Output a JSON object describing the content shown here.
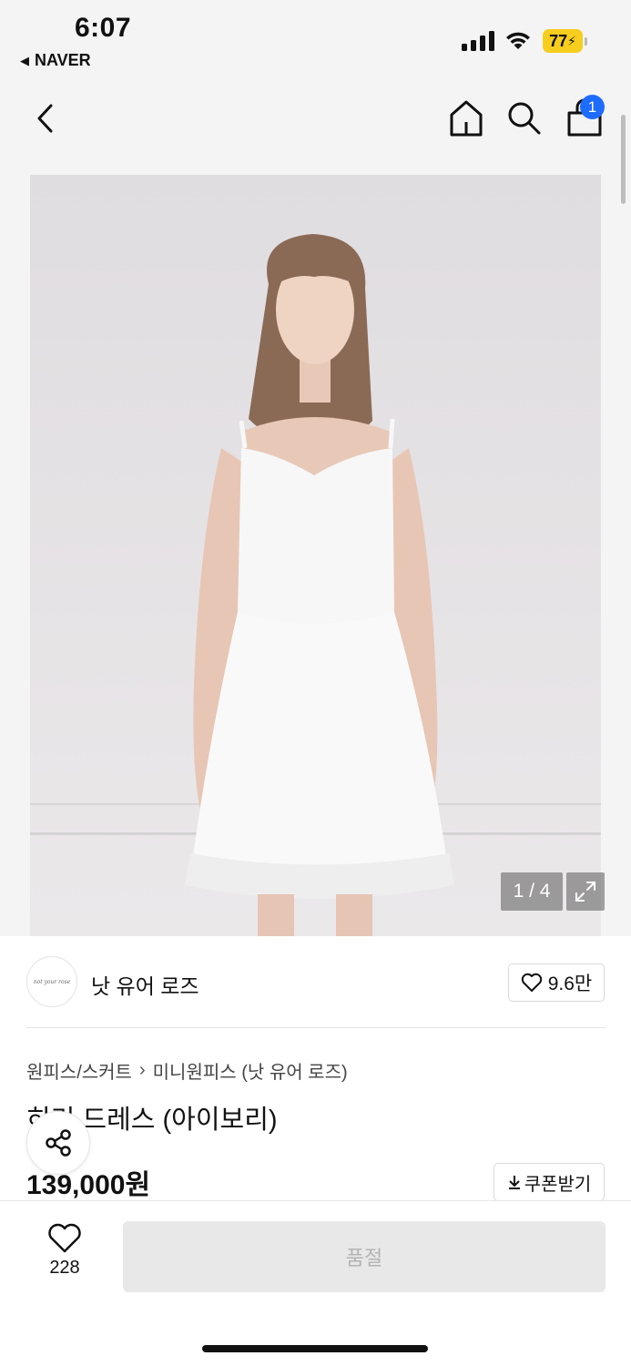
{
  "status_bar": {
    "time": "6:07",
    "back_app": "NAVER",
    "battery": "77"
  },
  "topnav": {
    "cart_count": "1"
  },
  "image": {
    "counter": "1 / 4"
  },
  "brand": {
    "name": "낫 유어 로즈",
    "logo_text": "not your rose",
    "likes": "9.6만"
  },
  "breadcrumb": {
    "category": "원피스/스커트",
    "separator": "›",
    "subcategory": "미니원피스 (낫 유어 로즈)"
  },
  "product": {
    "title": "히리 드레스 (아이보리)",
    "price": "139,000원"
  },
  "coupon": {
    "label": "쿠폰받기"
  },
  "bottom": {
    "wish_count": "228",
    "soldout_label": "품절"
  }
}
